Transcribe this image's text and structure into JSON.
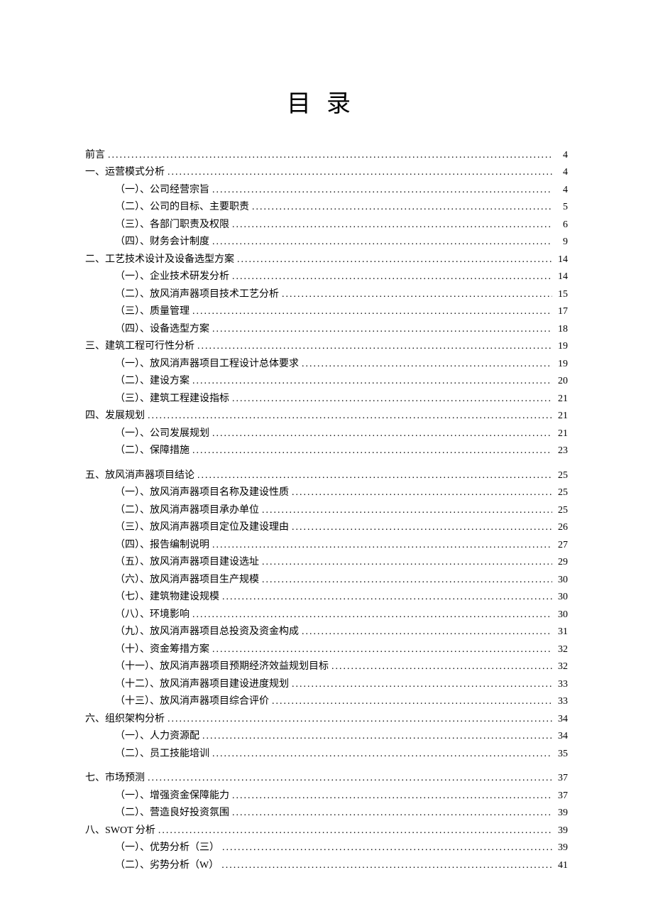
{
  "title": "目录",
  "entries": [
    {
      "label": "前言",
      "page": "4",
      "level": 0
    },
    {
      "label": "一、运营模式分析",
      "page": "4",
      "level": 0
    },
    {
      "label": "（一）、公司经营宗旨",
      "page": "4",
      "level": 1
    },
    {
      "label": "（二）、公司的目标、主要职责",
      "page": "5",
      "level": 1
    },
    {
      "label": "（三）、各部门职责及权限",
      "page": "6",
      "level": 1
    },
    {
      "label": "（四）、财务会计制度",
      "page": "9",
      "level": 1
    },
    {
      "label": "二、工艺技术设计及设备选型方案",
      "page": "14",
      "level": 0
    },
    {
      "label": "（一）、企业技术研发分析",
      "page": "14",
      "level": 1
    },
    {
      "label": "（二）、放风消声器项目技术工艺分析",
      "page": "15",
      "level": 1
    },
    {
      "label": "（三）、质量管理",
      "page": "17",
      "level": 1
    },
    {
      "label": "（四）、设备选型方案",
      "page": "18",
      "level": 1
    },
    {
      "label": "三、建筑工程可行性分析",
      "page": "19",
      "level": 0
    },
    {
      "label": "（一）、放风消声器项目工程设计总体要求",
      "page": "19",
      "level": 1
    },
    {
      "label": "（二）、建设方案",
      "page": "20",
      "level": 1
    },
    {
      "label": "（三）、建筑工程建设指标",
      "page": "21",
      "level": 1
    },
    {
      "label": "四、发展规划",
      "page": "21",
      "level": 0
    },
    {
      "label": "（一）、公司发展规划",
      "page": "21",
      "level": 1
    },
    {
      "label": "（二）、保障措施",
      "page": "23",
      "level": 1
    },
    {
      "label": "__SPACER__",
      "page": "",
      "level": 0
    },
    {
      "label": "五、放风消声器项目结论",
      "page": "25",
      "level": 0
    },
    {
      "label": "（一）、放风消声器项目名称及建设性质",
      "page": "25",
      "level": 1
    },
    {
      "label": "（二）、放风消声器项目承办单位",
      "page": "25",
      "level": 1
    },
    {
      "label": "（三）、放风消声器项目定位及建设理由",
      "page": "26",
      "level": 1
    },
    {
      "label": "（四）、报告编制说明",
      "page": "27",
      "level": 1
    },
    {
      "label": "（五）、放风消声器项目建设选址",
      "page": "29",
      "level": 1
    },
    {
      "label": "（六）、放风消声器项目生产规模",
      "page": "30",
      "level": 1
    },
    {
      "label": "（七）、建筑物建设规模",
      "page": "30",
      "level": 1
    },
    {
      "label": "（八）、环境影响",
      "page": "30",
      "level": 1
    },
    {
      "label": "（九）、放风消声器项目总投资及资金构成",
      "page": "31",
      "level": 1
    },
    {
      "label": "（十）、资金筹措方案",
      "page": "32",
      "level": 1
    },
    {
      "label": "（十一）、放风消声器项目预期经济效益规划目标",
      "page": "32",
      "level": 1
    },
    {
      "label": "（十二）、放风消声器项目建设进度规划",
      "page": "33",
      "level": 1
    },
    {
      "label": "（十三）、放风消声器项目综合评价",
      "page": "33",
      "level": 1
    },
    {
      "label": "六、组织架构分析",
      "page": "34",
      "level": 0
    },
    {
      "label": "（一）、人力资源配",
      "page": "34",
      "level": 1
    },
    {
      "label": "（二）、员工技能培训",
      "page": "35",
      "level": 1
    },
    {
      "label": "__SPACER__",
      "page": "",
      "level": 0
    },
    {
      "label": "七、市场预测",
      "page": "37",
      "level": 0
    },
    {
      "label": "（一）、增强资金保障能力",
      "page": "37",
      "level": 1
    },
    {
      "label": "（二）、营造良好投资氛围",
      "page": "39",
      "level": 1
    },
    {
      "label": "八、SWOT 分析",
      "page": "39",
      "level": 0
    },
    {
      "label": "（一）、优势分析（三）",
      "page": "39",
      "level": 1
    },
    {
      "label": "（二）、劣势分析（W）",
      "page": "41",
      "level": 1
    }
  ]
}
